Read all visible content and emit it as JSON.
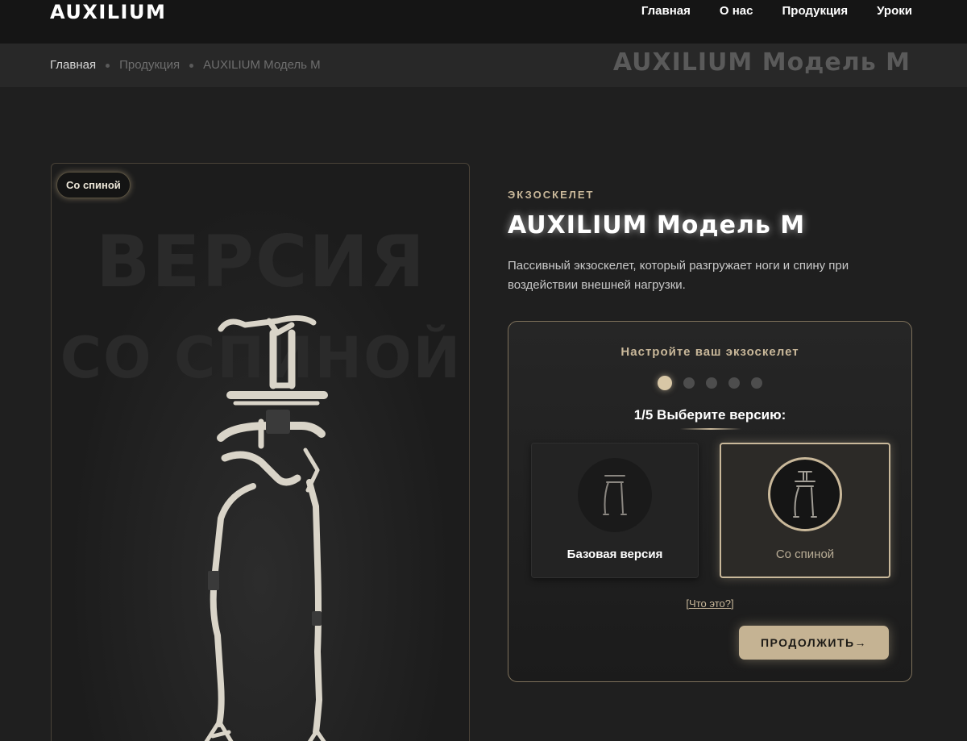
{
  "header": {
    "logo": "AUXILIUM",
    "nav": [
      "Главная",
      "О нас",
      "Продукция",
      "Уроки"
    ]
  },
  "breadcrumb": {
    "items": [
      "Главная",
      "Продукция",
      "AUXILIUM Модель M"
    ],
    "page_title": "AUXILIUM Модель M"
  },
  "product_card": {
    "tag": "Со спиной",
    "watermark_line1": "ВЕРСИЯ",
    "watermark_line2": "СО СПИНОЙ"
  },
  "product": {
    "eyebrow": "ЭКЗОСКЕЛЕТ",
    "title": "AUXILIUM Модель M",
    "description": "Пассивный экзоскелет, который разгружает ноги и спину при воздействии внешней нагрузки."
  },
  "configurator": {
    "heading": "Настройте ваш экзоскелет",
    "steps_total": 5,
    "current_step": 1,
    "step_title": "1/5 Выберите версию:",
    "options": [
      {
        "label": "Базовая версия",
        "selected": false
      },
      {
        "label": "Со спиной",
        "selected": true
      }
    ],
    "help_link": "[Что это?]",
    "continue_label": "ПРОДОЛЖИТЬ→"
  },
  "colors": {
    "accent": "#c9b89a",
    "background": "#1f1f1f",
    "button": "#c5b393"
  }
}
